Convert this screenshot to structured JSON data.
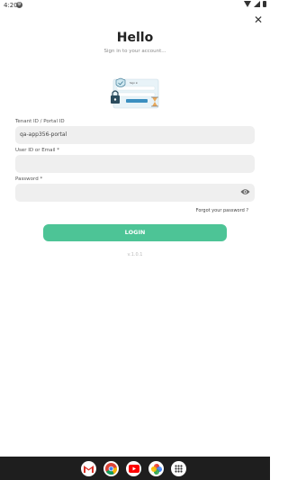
{
  "status_bar": {
    "time": "4:20"
  },
  "header": {
    "title": "Hello",
    "subtitle": "Sign in to your account..."
  },
  "illustration": {
    "card_title": "Sign in"
  },
  "form": {
    "tenant_label": "Tenant ID / Portal ID",
    "tenant_value": "qa-app356-portal",
    "user_label": "User ID or Email *",
    "user_value": "",
    "password_label": "Password *",
    "password_value": "",
    "forgot_label": "Forgot your password ?",
    "login_label": "LOGIN"
  },
  "version": "v.1.0.1",
  "colors": {
    "accent": "#4dc496",
    "field_bg": "#efefef"
  },
  "dock": {
    "apps": [
      "gmail-icon",
      "chrome-icon",
      "youtube-icon",
      "photos-icon",
      "app-drawer-icon"
    ]
  }
}
